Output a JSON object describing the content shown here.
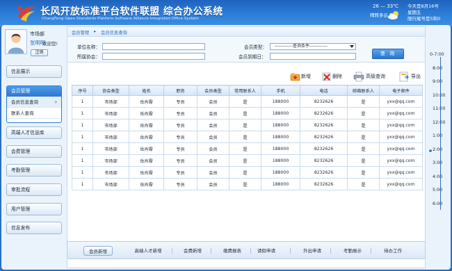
{
  "header": {
    "title": "长风开放标准平台软件联盟 综合办公系统",
    "subtitle": "ChangFeng Open Standards Platform Software Alliance Integrated Office System",
    "weather": {
      "temp": "26 — 33℃",
      "condition": "晴转多云",
      "icon": "partly-cloudy-icon"
    },
    "date_lines": [
      "今天是8月16号",
      "星期五",
      "限行尾号是5和0"
    ]
  },
  "user": {
    "dept": "市场部",
    "name": "张明明",
    "welcome": "欢迎您!",
    "logout": "注销"
  },
  "sidebar": {
    "items_top": [
      "信息展示"
    ],
    "active_group": {
      "title": "会员管理",
      "items": [
        "会员信息查询",
        "联系人查询"
      ]
    },
    "items_bottom": [
      "高端人才信息库",
      "会费管理",
      "考勤管理",
      "审批流程",
      "用户管理",
      "信息发布"
    ]
  },
  "breadcrumb": [
    "会员管理",
    "会员信息查询"
  ],
  "search": {
    "unit_name_label": "单位名称：",
    "association_label": "所属协会：",
    "member_type_label": "会员类型：",
    "member_type_value": "------------查询条件------------",
    "expire_label": "会员到期日：",
    "query_button": "查 询"
  },
  "toolbar": {
    "add": "新增",
    "delete": "删除",
    "advanced": "高级查询",
    "export": "导出"
  },
  "table": {
    "headers": [
      "序号",
      "协会类型",
      "姓名",
      "职务",
      "会员类型",
      "常用联系人",
      "手机",
      "电话",
      "邮箱联系人",
      "电子邮件"
    ],
    "rows": [
      [
        "1",
        "市场部",
        "岳肖霏",
        "专员",
        "会员",
        "是",
        "188000",
        "8232626",
        "是",
        "yxx@qq.com"
      ],
      [
        "1",
        "市场部",
        "岳肖霏",
        "专员",
        "会员",
        "是",
        "188000",
        "8232626",
        "是",
        "yxx@qq.com"
      ],
      [
        "1",
        "市场部",
        "岳肖霏",
        "专员",
        "会员",
        "是",
        "188000",
        "8232626",
        "是",
        "yxx@qq.com"
      ],
      [
        "1",
        "市场部",
        "岳肖霏",
        "专员",
        "会员",
        "是",
        "188000",
        "8232626",
        "是",
        "yxx@qq.com"
      ],
      [
        "1",
        "市场部",
        "岳肖霏",
        "专员",
        "会员",
        "是",
        "188000",
        "8232626",
        "是",
        "yxx@qq.com"
      ],
      [
        "1",
        "市场部",
        "岳肖霏",
        "专员",
        "会员",
        "是",
        "188000",
        "8232626",
        "是",
        "yxx@qq.com"
      ],
      [
        "1",
        "市场部",
        "岳肖霏",
        "专员",
        "会员",
        "是",
        "188000",
        "8232626",
        "是",
        "yxx@qq.com"
      ],
      [
        "1",
        "市场部",
        "岳肖霏",
        "专员",
        "会员",
        "是",
        "188000",
        "8232626",
        "是",
        "yxx@qq.com"
      ]
    ]
  },
  "bottom_tabs": [
    "会员新增",
    "高端人才新增",
    "会费新增",
    "缴费报表",
    "请假申请",
    "外出申请",
    "考勤展示",
    "待办工作"
  ],
  "timeline": [
    "0-7:00",
    "8:00",
    "9:00",
    "10:00",
    "11:00",
    "12:00",
    "1:00",
    "2:00",
    "3:00",
    "4:00",
    "5:00",
    "6:00"
  ],
  "colors": {
    "brand": "#2d7ed8",
    "accent": "#2b74cd",
    "header_bg": "#1f63bd"
  }
}
